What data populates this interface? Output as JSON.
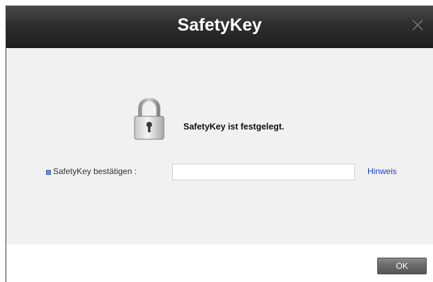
{
  "window": {
    "title": "SafetyKey",
    "close_icon": "close-icon"
  },
  "main": {
    "lock_icon": "lock-icon",
    "status_text": "SafetyKey ist festgelegt.",
    "confirm_label": "SafetyKey bestätigen :",
    "confirm_input_value": "",
    "hint_link": "Hinweis"
  },
  "footer": {
    "ok_label": "OK"
  },
  "colors": {
    "titlebar": "#2e2e2e",
    "content_bg": "#f1f1f1",
    "link": "#1a3fd6",
    "bullet": "#6a8fd8"
  }
}
